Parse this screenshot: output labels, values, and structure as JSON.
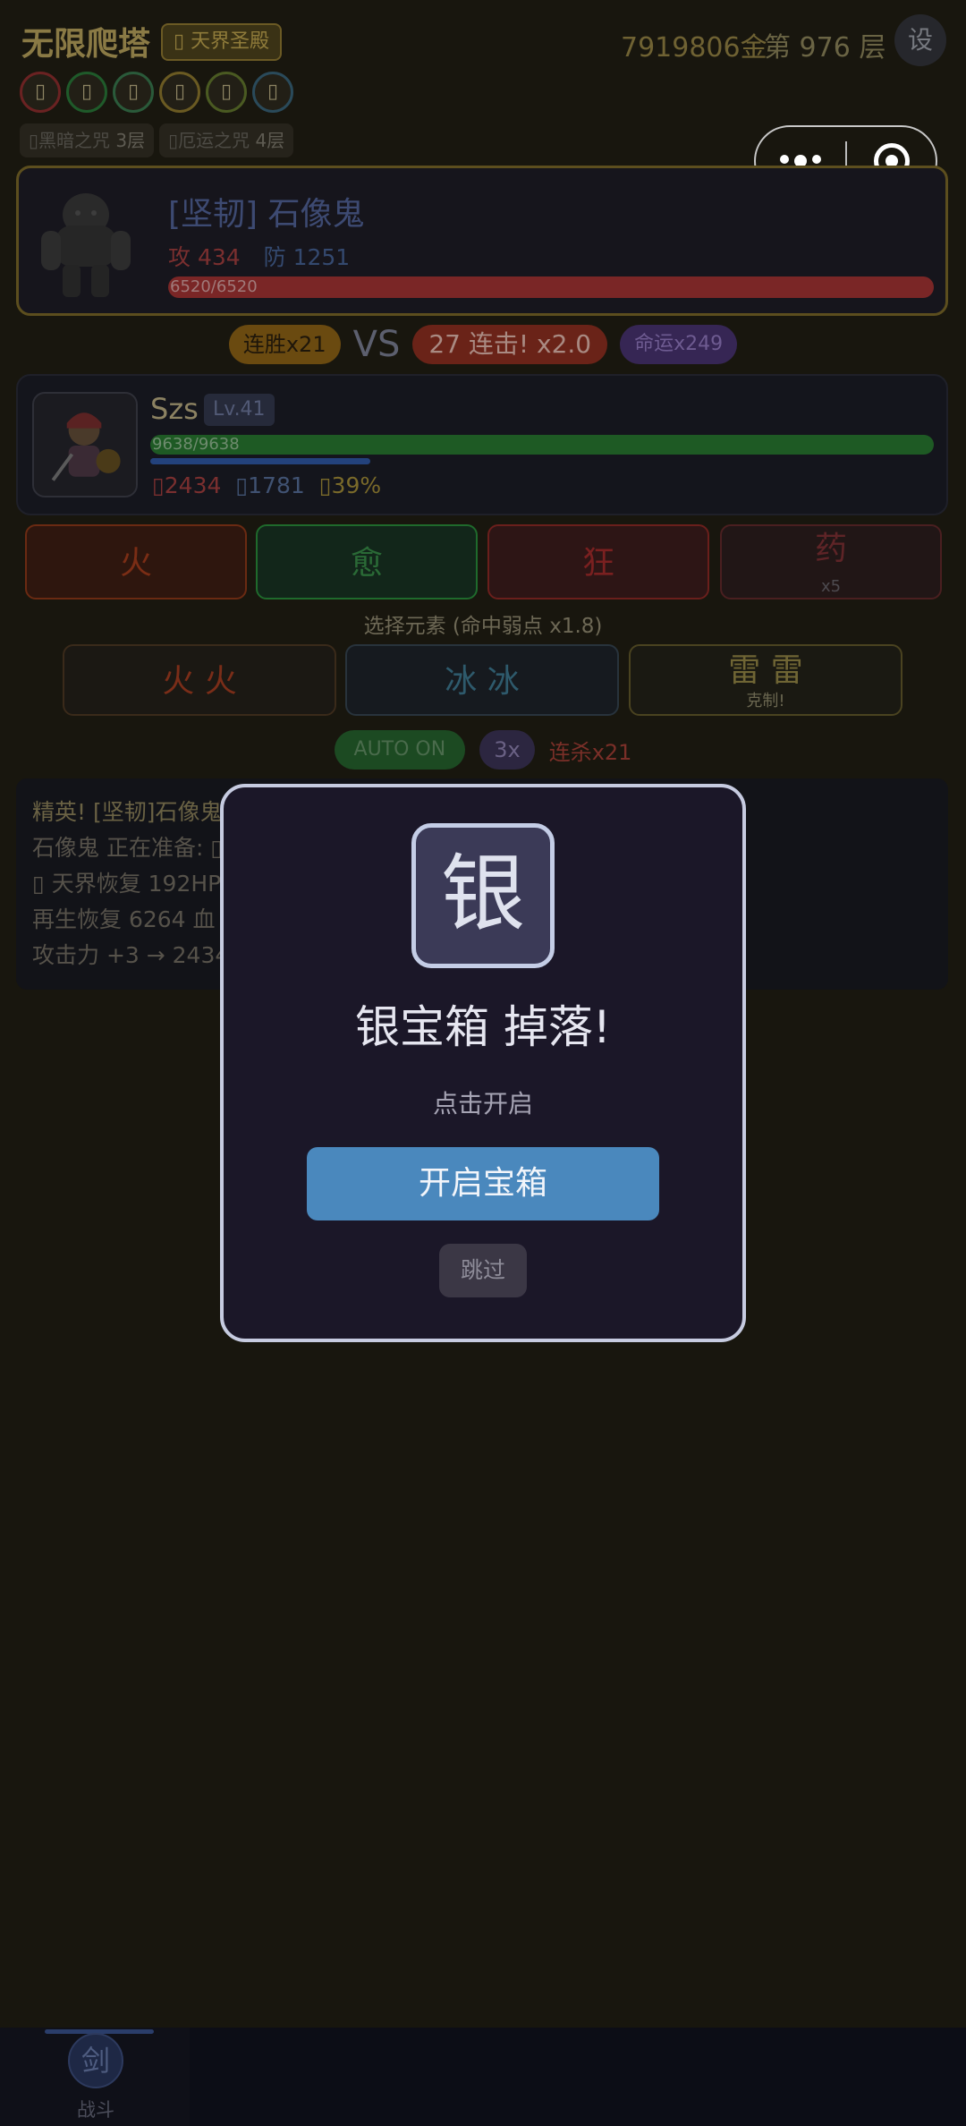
{
  "header": {
    "title": "无限爬塔",
    "realm_badge": "▯ 天界圣殿",
    "gold": "7919806金",
    "floor": "第 976 层",
    "settings_label": "设",
    "element_dots": [
      "▯",
      "▯",
      "▯",
      "▯",
      "▯",
      "▯"
    ],
    "element_dot_colors": [
      "#6a2222",
      "#1f5a2a",
      "#2a5a3a",
      "#6a5a22",
      "#4a5a22",
      "#2a4a5a"
    ],
    "curses": [
      {
        "name": "▯黑暗之咒",
        "level": "3层"
      },
      {
        "name": "▯厄运之咒",
        "level": "4层"
      }
    ]
  },
  "enemy": {
    "name": "[坚韧] 石像鬼",
    "attack": "攻 434",
    "defense": "防 1251",
    "hp_text": "6520/6520",
    "hp_fraction": 1.0
  },
  "vs_row": {
    "streak": "连胜x21",
    "vs": "VS",
    "combo": "27 连击! x2.0",
    "fate": "命运x249"
  },
  "hero": {
    "name": "Szs",
    "level": "Lv.41",
    "hp_text": "9638/9638",
    "hp_fraction": 1.0,
    "xp_fraction": 0.28,
    "attack": "▯2434",
    "defense": "▯1781",
    "crit": "▯39%"
  },
  "skills": [
    {
      "label": "火"
    },
    {
      "label": "愈"
    },
    {
      "label": "狂"
    },
    {
      "label": "药",
      "count": "x5"
    }
  ],
  "element_select": {
    "hint": "选择元素 (命中弱点 x1.8)",
    "fire": "火 火",
    "ice": "冰 冰",
    "thunder": "雷 雷",
    "thunder_note": "克制!"
  },
  "auto_row": {
    "auto": "AUTO ON",
    "speed": "3x",
    "kills": "连杀x21"
  },
  "log": [
    "精英! [坚韧]石像鬼 出现!",
    "石像鬼 正在准备: ▯",
    "▯ 天界恢复 192HP",
    "再生恢复 6264 血",
    "攻击力 +3 → 2434"
  ],
  "nav": {
    "icon": "剑",
    "label": "战斗"
  },
  "modal": {
    "chest_glyph": "银",
    "title": "银宝箱 掉落!",
    "subtitle": "点击开启",
    "open_button": "开启宝箱",
    "skip_button": "跳过"
  },
  "colors": {
    "modal_border": "#c6cbe0",
    "open_button": "#4a88bd",
    "hero_hp": "#1e5a24",
    "enemy_hp": "#7a2626"
  }
}
